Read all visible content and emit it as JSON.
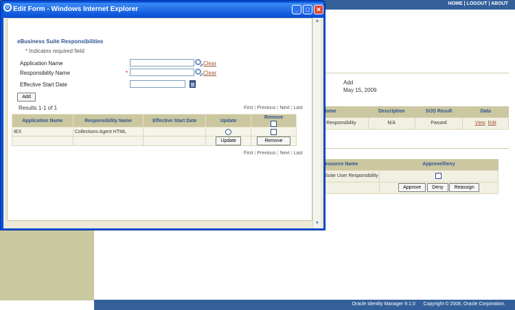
{
  "background": {
    "top_links": {
      "home": "HOME",
      "logout": "LOGOUT",
      "about": "ABOUT",
      "sep": "|"
    },
    "request": {
      "action": "Add",
      "date": "May 15, 2009"
    },
    "table1": {
      "headers": [
        "Name",
        "Description",
        "SOD Result",
        "Data"
      ],
      "row": {
        "name": "r Responsibility",
        "description": "N/A",
        "sod_result": "Passed",
        "view": "View",
        "edit": "Edit"
      }
    },
    "table2": {
      "headers": [
        "Resource Name",
        "Approve/Deny"
      ],
      "row": {
        "name": "Suite User Responsibility"
      },
      "buttons": {
        "approve": "Approve",
        "deny": "Deny",
        "reassign": "Reassign"
      }
    },
    "footer": {
      "product": "Oracle Identity Manager 9.1.0",
      "copyright": "Copyright © 2008, Oracle Corporation."
    }
  },
  "popup": {
    "title": "Edit Form - Windows Internet Explorer",
    "section_title": "eBusiness Suite Responsibilities",
    "required_note": "* Indicates required field",
    "fields": {
      "application_name": {
        "label": "Application Name",
        "value": "",
        "clear": "Clear"
      },
      "responsibility_name": {
        "label": "Responsibility Name",
        "required_mark": "*",
        "value": "",
        "clear": "Clear"
      },
      "effective_start_date": {
        "label": "Effective Start Date",
        "value": ""
      }
    },
    "add_button": "Add",
    "results_label": "Results 1-1 of 1",
    "pager": {
      "first": "First",
      "previous": "Previous",
      "next": "Next",
      "last": "Last",
      "sep": "|"
    },
    "table": {
      "headers": {
        "application_name": "Application Name",
        "responsibility_name": "Responsibility Name",
        "effective_start_date": "Effective Start Date",
        "update": "Update",
        "remove": "Remove"
      },
      "rows": [
        {
          "application_name": "IEX",
          "responsibility_name": "Collections Agent HTML",
          "effective_start_date": ""
        }
      ],
      "update_button": "Update",
      "remove_button": "Remove"
    }
  }
}
